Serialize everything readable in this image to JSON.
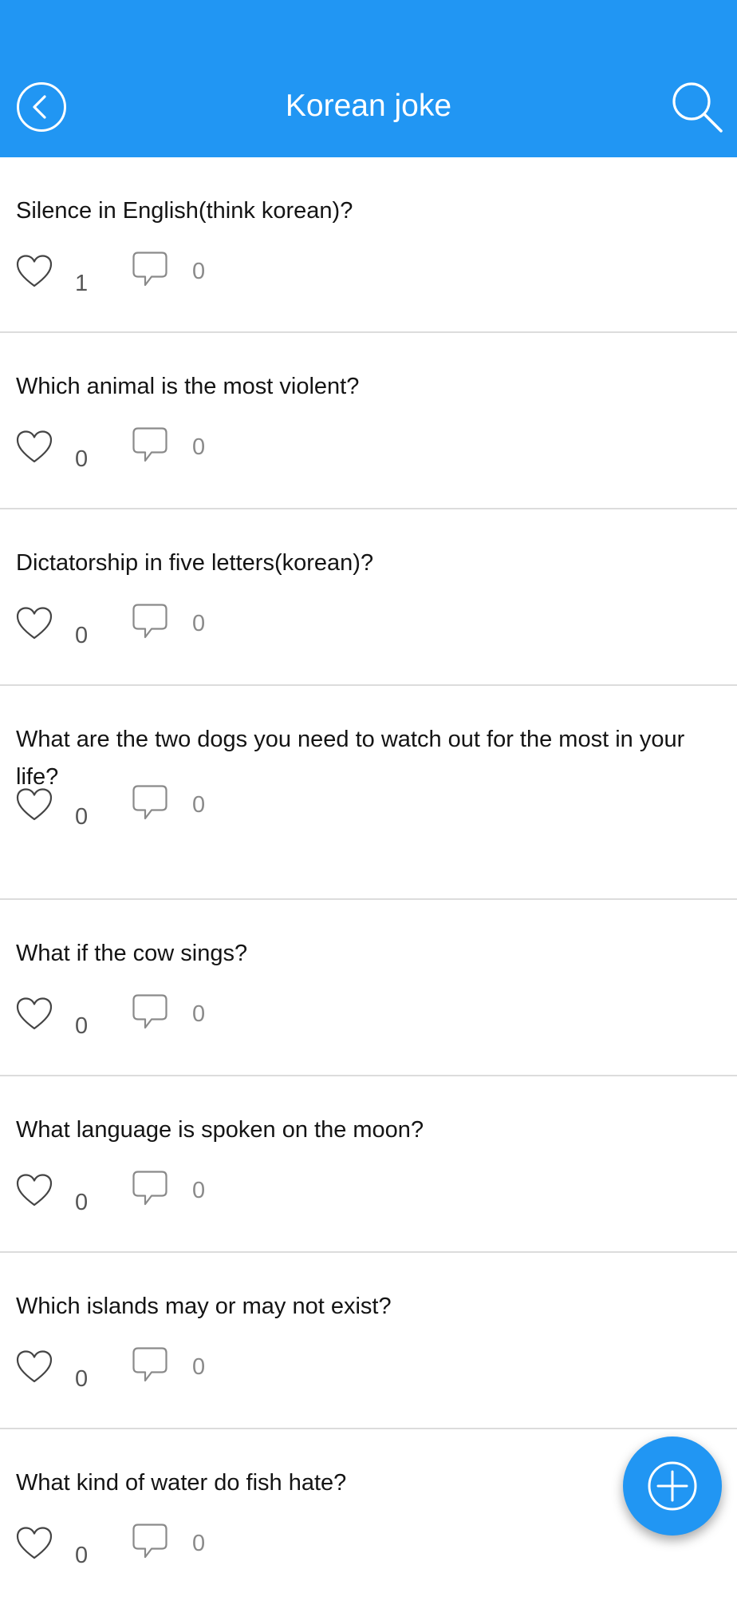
{
  "colors": {
    "accent": "#2196F3"
  },
  "header": {
    "title": "Korean joke",
    "back_icon": "chevron-left-circle-icon",
    "search_icon": "search-icon"
  },
  "posts": [
    {
      "question": "Silence in English(think korean)?",
      "likes": "1",
      "comments": "0"
    },
    {
      "question": "Which animal is the most violent?",
      "likes": "0",
      "comments": "0"
    },
    {
      "question": "Dictatorship in five letters(korean)?",
      "likes": "0",
      "comments": "0"
    },
    {
      "question": "What are the two dogs you need to watch out for the most in your life?",
      "likes": "0",
      "comments": "0"
    },
    {
      "question": "What if the cow sings?",
      "likes": "0",
      "comments": "0"
    },
    {
      "question": "What language is spoken on the moon?",
      "likes": "0",
      "comments": "0"
    },
    {
      "question": "Which islands may or may not exist?",
      "likes": "0",
      "comments": "0"
    },
    {
      "question": "What kind of water do fish hate?",
      "likes": "0",
      "comments": "0"
    }
  ],
  "fab": {
    "icon": "plus-circle-icon"
  }
}
